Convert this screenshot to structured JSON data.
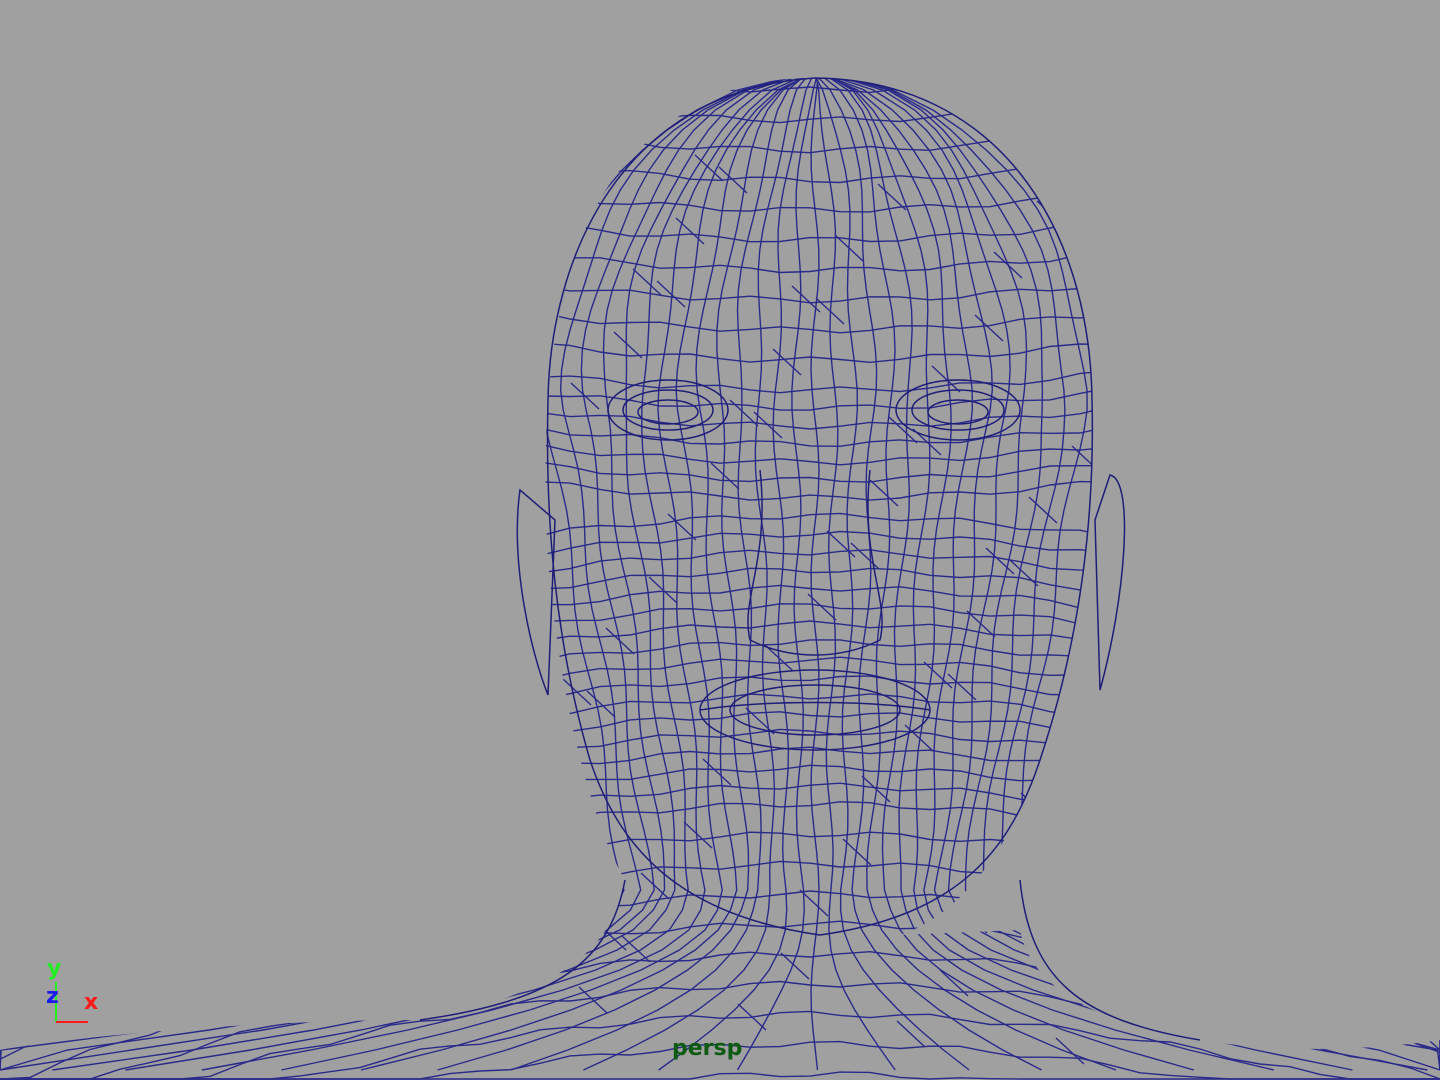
{
  "viewport": {
    "camera_label": "persp",
    "background_color": "#a0a0a0",
    "wireframe_color": "#2a2a8a",
    "object": "head-mesh-wireframe"
  },
  "axis_gizmo": {
    "x_label": "x",
    "y_label": "y",
    "z_label": "z",
    "x_color": "#ff1a1a",
    "y_color": "#22ee22",
    "z_color": "#1a1aee"
  }
}
